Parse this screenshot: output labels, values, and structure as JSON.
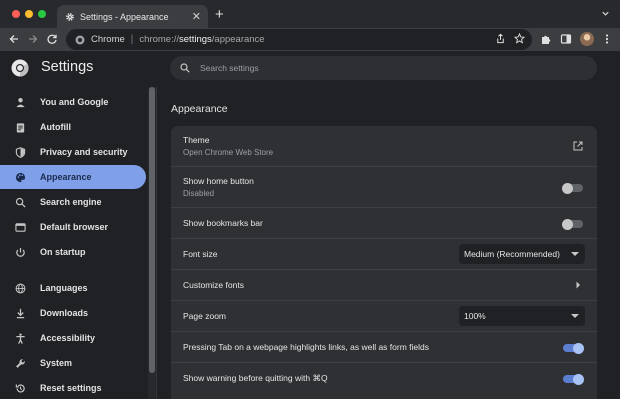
{
  "browser": {
    "tab": {
      "title": "Settings - Appearance",
      "close": "✕"
    },
    "new_tab": "+",
    "omnibox": {
      "site_name": "Chrome",
      "separator": "|",
      "url_prefix": "chrome://",
      "url_host": "settings",
      "url_suffix": "/appearance"
    }
  },
  "header": {
    "title": "Settings",
    "search_placeholder": "Search settings"
  },
  "sidebar": {
    "items": [
      {
        "label": "You and Google",
        "icon": "person-icon",
        "active": false
      },
      {
        "label": "Autofill",
        "icon": "clipboard-icon",
        "active": false
      },
      {
        "label": "Privacy and security",
        "icon": "shield-icon",
        "active": false
      },
      {
        "label": "Appearance",
        "icon": "palette-icon",
        "active": true
      },
      {
        "label": "Search engine",
        "icon": "search-icon",
        "active": false
      },
      {
        "label": "Default browser",
        "icon": "browser-icon",
        "active": false
      },
      {
        "label": "On startup",
        "icon": "power-icon",
        "active": false
      },
      {
        "label": "Languages",
        "icon": "globe-icon",
        "active": false
      },
      {
        "label": "Downloads",
        "icon": "download-icon",
        "active": false
      },
      {
        "label": "Accessibility",
        "icon": "accessibility-icon",
        "active": false
      },
      {
        "label": "System",
        "icon": "wrench-icon",
        "active": false
      },
      {
        "label": "Reset settings",
        "icon": "reset-icon",
        "active": false
      }
    ]
  },
  "appearance": {
    "section_title": "Appearance",
    "theme": {
      "label": "Theme",
      "sub": "Open Chrome Web Store"
    },
    "home_button": {
      "label": "Show home button",
      "sub": "Disabled",
      "enabled": false
    },
    "bookmarks_bar": {
      "label": "Show bookmarks bar",
      "enabled": false
    },
    "font_size": {
      "label": "Font size",
      "value": "Medium (Recommended)"
    },
    "customize_fonts": {
      "label": "Customize fonts"
    },
    "page_zoom": {
      "label": "Page zoom",
      "value": "100%"
    },
    "tab_highlights": {
      "label": "Pressing Tab on a webpage highlights links, as well as form fields",
      "enabled": true
    },
    "quit_warning": {
      "label": "Show warning before quitting with ⌘Q",
      "enabled": true
    }
  },
  "colors": {
    "accent": "#7fa0e9",
    "toggle_on": "#5c7ed0",
    "background": "#202124",
    "card": "#2f3034"
  }
}
